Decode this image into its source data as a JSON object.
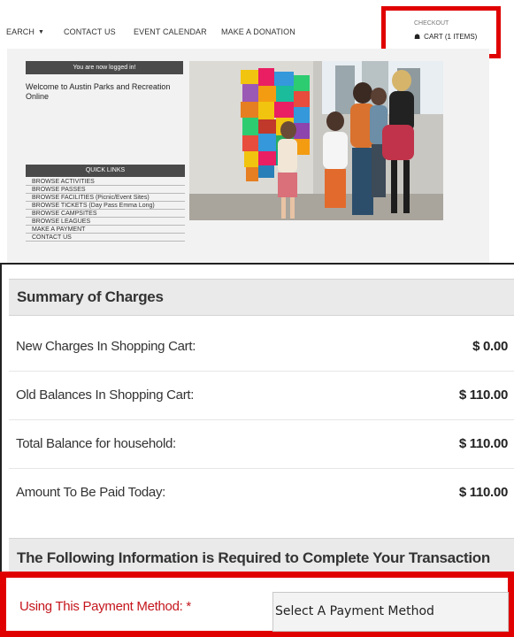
{
  "nav": {
    "search_label": "EARCH",
    "contact": "CONTACT US",
    "events": "EVENT CALENDAR",
    "donate": "MAKE A DONATION",
    "checkout": "CHECKOUT",
    "cart": "CART (1 ITEMS)"
  },
  "sidebar": {
    "logged_in": "You are now logged in!",
    "welcome": "Welcome to Austin Parks and Recreation Online",
    "quick_links_title": "QUICK LINKS",
    "quick_links": [
      "BROWSE ACTIVITIES",
      "BROWSE PASSES",
      "BROWSE FACILITIES (Picnic/Event Sites)",
      "BROWSE TICKETS (Day Pass Emma Long)",
      "BROWSE CAMPSITES",
      "BROWSE LEAGUES",
      "MAKE A PAYMENT",
      "CONTACT US"
    ]
  },
  "summary": {
    "title": "Summary of Charges",
    "rows": [
      {
        "label": "New Charges In Shopping Cart:",
        "value": "$ 0.00"
      },
      {
        "label": "Old Balances In Shopping Cart:",
        "value": "$ 110.00"
      },
      {
        "label": "Total Balance for household:",
        "value": "$ 110.00"
      },
      {
        "label": "Amount To Be Paid Today:",
        "value": "$ 110.00"
      }
    ],
    "required_title": "The Following Information is Required to Complete Your Transaction"
  },
  "payment": {
    "label": "Using This Payment Method: *",
    "select_value": "Select A Payment Method"
  },
  "colors": {
    "highlight": "#e00000",
    "required_label": "#c4161c",
    "sidebar_bar": "#4a4a4a"
  },
  "icons": {
    "cart": "shopping-basket-icon",
    "search_menu": "caret-down-icon"
  }
}
